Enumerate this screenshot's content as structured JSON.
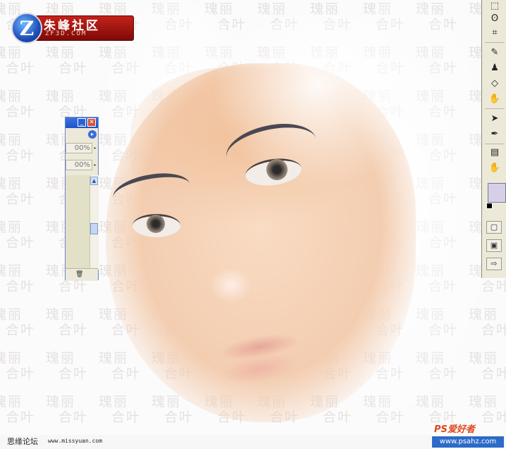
{
  "watermark": {
    "line1": "瑰丽",
    "line2": "合叶"
  },
  "logo": {
    "glyph": "Z",
    "title": "朱峰社区",
    "subtitle": "ZF3D.COM"
  },
  "palette": {
    "minimize": "_",
    "close": "✕",
    "menu": "▸",
    "field1": "00%",
    "field2": "00%",
    "scroll_up": "▲",
    "trash": "🗑"
  },
  "toolbox": {
    "tools": [
      "⬚",
      "ʘ",
      "⌗",
      "✎",
      "♟",
      "◇",
      "✋",
      "➤",
      "✒",
      "▤",
      "✋"
    ],
    "modes": [
      "▢",
      "▣",
      "⇨"
    ],
    "colors": {
      "foreground": "#d5d0e8",
      "background": "#000000"
    }
  },
  "footer": {
    "forum": "思缘论坛",
    "url": "www.missyuan.com",
    "brand": "PS爱好者",
    "brand_url": "www.psahz.com"
  }
}
